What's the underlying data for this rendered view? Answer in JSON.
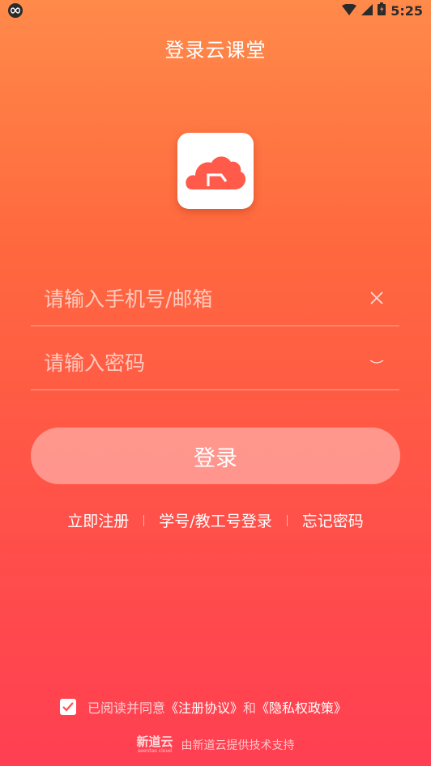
{
  "status": {
    "time": "5:25",
    "app_icon": "infinity-icon"
  },
  "header": {
    "title": "登录云课堂"
  },
  "form": {
    "account_placeholder": "请输入手机号/邮箱",
    "password_placeholder": "请输入密码",
    "login_label": "登录"
  },
  "links": {
    "register": "立即注册",
    "student_login": "学号/教工号登录",
    "forgot": "忘记密码"
  },
  "agreement": {
    "checked": true,
    "prefix": "已阅读并同意",
    "terms": "《注册协议》",
    "and": "和",
    "privacy": "《隐私权政策》"
  },
  "footer": {
    "brand": "新道云",
    "brand_sub": "seentao cloud",
    "text": "由新道云提供技术支持"
  },
  "colors": {
    "gradient_top": "#ff8a4a",
    "gradient_bottom": "#ff3f52",
    "logo_cloud": "#ff5a4a"
  }
}
